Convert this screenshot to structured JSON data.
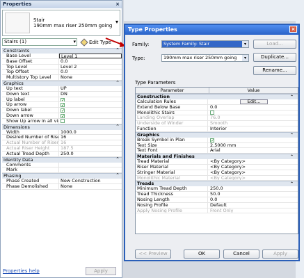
{
  "properties": {
    "title": "Properties",
    "close_glyph": "×",
    "type_name_line1": "Stair",
    "type_name_line2": "190mm max riser 250mm going",
    "instance_filter": "Stairs (1)",
    "edit_type_label": "Edit Type",
    "help_link": "Properties help",
    "apply_label": "Apply",
    "groups": [
      {
        "label": "Constraints",
        "rows": [
          {
            "k": "Base Level",
            "v": "Level 1",
            "selected": true
          },
          {
            "k": "Base Offset",
            "v": "0.0"
          },
          {
            "k": "Top Level",
            "v": "Level 2"
          },
          {
            "k": "Top Offset",
            "v": "0.0"
          },
          {
            "k": "Multistory Top Level",
            "v": "None"
          }
        ]
      },
      {
        "label": "Graphics",
        "rows": [
          {
            "k": "Up text",
            "v": "UP"
          },
          {
            "k": "Down text",
            "v": "DN"
          },
          {
            "k": "Up label",
            "check": true
          },
          {
            "k": "Up arrow",
            "check": true
          },
          {
            "k": "Down label",
            "check": true
          },
          {
            "k": "Down arrow",
            "check": true
          },
          {
            "k": "Show Up arrow in all views",
            "check": false
          }
        ]
      },
      {
        "label": "Dimensions",
        "rows": [
          {
            "k": "Width",
            "v": "1000.0"
          },
          {
            "k": "Desired Number of Risers",
            "v": "16"
          },
          {
            "k": "Actual Number of Risers",
            "v": "16",
            "dim": true
          },
          {
            "k": "Actual Riser Height",
            "v": "187.5",
            "dim": true
          },
          {
            "k": "Actual Tread Depth",
            "v": "250.0"
          }
        ]
      },
      {
        "label": "Identity Data",
        "rows": [
          {
            "k": "Comments",
            "v": ""
          },
          {
            "k": "Mark",
            "v": ""
          }
        ]
      },
      {
        "label": "Phasing",
        "rows": [
          {
            "k": "Phase Created",
            "v": "New Construction"
          },
          {
            "k": "Phase Demolished",
            "v": "None"
          }
        ]
      }
    ]
  },
  "dialog": {
    "title": "Type Properties",
    "close_glyph": "×",
    "family_label": "Family:",
    "family_value": "System Family: Stair",
    "type_label": "Type:",
    "type_value": "190mm max riser 250mm going",
    "load_label": "Load...",
    "duplicate_label": "Duplicate...",
    "rename_label": "Rename...",
    "type_params_label": "Type Parameters",
    "col_parameter": "Parameter",
    "col_value": "Value",
    "groups": [
      {
        "label": "Construction",
        "rows": [
          {
            "k": "Calculation Rules",
            "v": "Edit...",
            "button": true
          },
          {
            "k": "Extend Below Base",
            "v": "0.0"
          },
          {
            "k": "Monolithic Stairs",
            "check": false
          },
          {
            "k": "Landing Overlap",
            "v": "76.0",
            "dim": true
          },
          {
            "k": "Underside of Winder",
            "v": "Smooth",
            "dim": true
          },
          {
            "k": "Function",
            "v": "Interior"
          }
        ]
      },
      {
        "label": "Graphics",
        "rows": [
          {
            "k": "Break Symbol in Plan",
            "check": true
          },
          {
            "k": "Text Size",
            "v": "2.5000 mm"
          },
          {
            "k": "Text Font",
            "v": "Arial"
          }
        ]
      },
      {
        "label": "Materials and Finishes",
        "rows": [
          {
            "k": "Tread Material",
            "v": "<By Category>"
          },
          {
            "k": "Riser Material",
            "v": "<By Category>"
          },
          {
            "k": "Stringer Material",
            "v": "<By Category>"
          },
          {
            "k": "Monolithic Material",
            "v": "<By Category>",
            "dim": true
          }
        ]
      },
      {
        "label": "Treads",
        "rows": [
          {
            "k": "Minimum Tread Depth",
            "v": "250.0"
          },
          {
            "k": "Tread Thickness",
            "v": "50.0"
          },
          {
            "k": "Nosing Length",
            "v": "0.0"
          },
          {
            "k": "Nosing Profile",
            "v": "Default"
          },
          {
            "k": "Apply Nosing Profile",
            "v": "Front Only",
            "dim": true
          }
        ]
      }
    ],
    "collapse_glyph": "⌃",
    "preview_label": "<< Preview",
    "ok_label": "OK",
    "cancel_label": "Cancel",
    "apply_label": "Apply"
  },
  "annotation_color": "#c00000"
}
